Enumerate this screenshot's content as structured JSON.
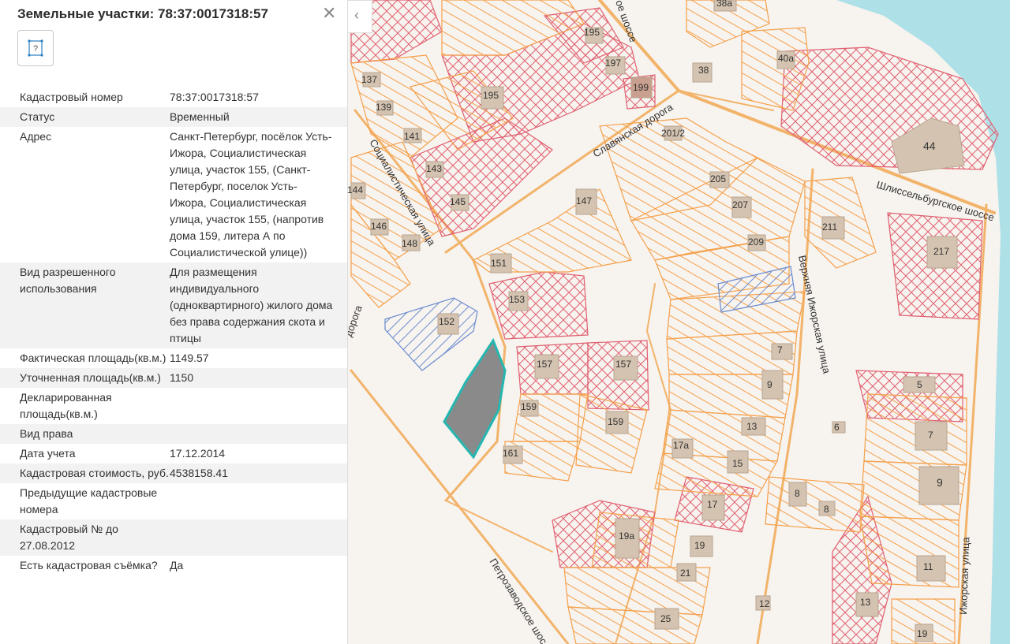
{
  "panel": {
    "title": "Земельные участки: 78:37:0017318:57",
    "close_glyph": "✕",
    "collapse_glyph": "‹",
    "feature_icon": "question-square-icon",
    "rows": [
      {
        "key": "Кадастровый номер",
        "value": "78:37:0017318:57"
      },
      {
        "key": "Статус",
        "value": "Временный"
      },
      {
        "key": "Адрес",
        "value": "Санкт-Петербург, посёлок Усть-Ижора, Социалистическая улица, участок 155, (Санкт-Петербург, поселок Усть-Ижора, Социалистическая улица, участок 155, (напротив дома 159, литера А по Социалистической улице))"
      },
      {
        "key": "Вид разрешенного использования",
        "value": "Для размещения индивидуального (одноквартирного) жилого дома без права содержания скота и птицы"
      },
      {
        "key": "Фактическая площадь(кв.м.)",
        "value": "1149.57"
      },
      {
        "key": "Уточненная площадь(кв.м.)",
        "value": "1150"
      },
      {
        "key": "Декларированная площадь(кв.м.)",
        "value": ""
      },
      {
        "key": "Вид права",
        "value": ""
      },
      {
        "key": "Дата учета",
        "value": "17.12.2014"
      },
      {
        "key": "Кадастровая стоимость, руб.",
        "value": "4538158.41"
      },
      {
        "key": "Предыдущие кадастровые номера",
        "value": ""
      },
      {
        "key": "Кадастровый № до 27.08.2012",
        "value": ""
      },
      {
        "key": "Есть кадастровая съёмка?",
        "value": "Да"
      }
    ]
  },
  "map": {
    "colors": {
      "parcel": "#f5a04a",
      "hatch_red": "#e06070",
      "building": "#d4c3b0",
      "selected_fill": "#8a8a8a",
      "selected_stroke": "#25b7b0",
      "blue": "#6b8ccf",
      "water": "#aee0e8",
      "road": "#f2b36a"
    },
    "street_labels": [
      {
        "name": "ое шоссе"
      },
      {
        "name": "Славянская дорога"
      },
      {
        "name": "Шлиссельбургское шоссе"
      },
      {
        "name": "Социалистическая улица"
      },
      {
        "name": "Верхняя Ижорская улица"
      },
      {
        "name": "Петрозаводское шос"
      },
      {
        "name": "Ижорская улица"
      },
      {
        "name": "дорога"
      }
    ],
    "house_numbers": [
      "38а",
      "195",
      "197",
      "199",
      "38",
      "40а",
      "137",
      "195",
      "139",
      "141",
      "201/2",
      "44",
      "143",
      "205",
      "145",
      "144",
      "147",
      "207",
      "146",
      "211",
      "148",
      "209",
      "217",
      "151",
      "153",
      "152",
      "7",
      "157",
      "157",
      "9",
      "5",
      "159",
      "159",
      "13",
      "6",
      "7",
      "17а",
      "161",
      "15",
      "9",
      "8",
      "8",
      "17",
      "19а",
      "19",
      "11",
      "21",
      "13",
      "12",
      "25",
      "19"
    ]
  }
}
